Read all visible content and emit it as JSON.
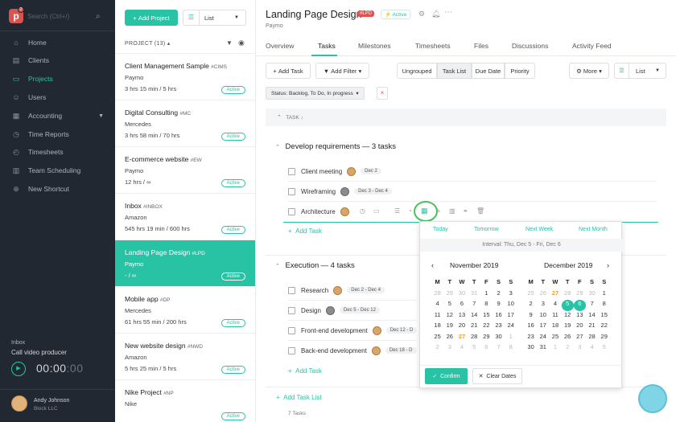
{
  "sidebar": {
    "logo_badge": "2",
    "search_placeholder": "Search (Ctrl+/)",
    "nav": [
      {
        "label": "Home",
        "icon": "home-icon"
      },
      {
        "label": "Clients",
        "icon": "clients-icon"
      },
      {
        "label": "Projects",
        "icon": "folder-icon"
      },
      {
        "label": "Users",
        "icon": "user-icon"
      },
      {
        "label": "Accounting",
        "icon": "accounting-icon"
      },
      {
        "label": "Time Reports",
        "icon": "clock-icon"
      },
      {
        "label": "Timesheets",
        "icon": "timesheet-icon"
      },
      {
        "label": "Team Scheduling",
        "icon": "calendar-icon"
      },
      {
        "label": "New Shortcut",
        "icon": "plus-circle-icon"
      }
    ],
    "inbox_label": "Inbox",
    "inbox_task": "Call video producer",
    "timer_main": "00:00",
    "timer_sec": ":00",
    "user_name": "Andy Johnson",
    "user_company": "Block LLC"
  },
  "project_list": {
    "add_button": "Add Project",
    "view": "List",
    "header": "PROJECT (13) ▴",
    "items": [
      {
        "name": "Client Management Sample",
        "code": "#CIMS",
        "client": "Paymo",
        "hours": "3 hrs 15 min / 5 hrs",
        "status": "Active"
      },
      {
        "name": "Digital Consulting",
        "code": "#MC",
        "client": "Mercedes",
        "hours": "3 hrs 58 min / 70 hrs",
        "status": "Active"
      },
      {
        "name": "E-commerce website",
        "code": "#EW",
        "client": "Paymo",
        "hours": "12 hrs / ∞",
        "status": "Active"
      },
      {
        "name": "Inbox",
        "code": "#INBOX",
        "client": "Amazon",
        "hours": "545 hrs 19 min / 600 hrs",
        "status": "Active"
      },
      {
        "name": "Landing Page Design",
        "code": "#LPD",
        "client": "Paymo",
        "hours": "- / ∞",
        "status": "Active"
      },
      {
        "name": "Mobile app",
        "code": "#DP",
        "client": "Mercedes",
        "hours": "61 hrs 55 min / 200 hrs",
        "status": "Active"
      },
      {
        "name": "New website design",
        "code": "#NWD",
        "client": "Amazon",
        "hours": "5 hrs 25 min / 5 hrs",
        "status": "Active"
      },
      {
        "name": "Nike Project",
        "code": "#NP",
        "client": "Nike",
        "hours": "",
        "status": "Active"
      }
    ]
  },
  "main": {
    "title": "Landing Page Design",
    "code_badge": "#LPD",
    "status": "Active",
    "client": "Paymo",
    "tabs": [
      "Overview",
      "Tasks",
      "Milestones",
      "Timesheets",
      "Files",
      "Discussions",
      "Activity Feed"
    ],
    "toolbar": {
      "add_task": "Add Task",
      "add_filter": "Add Filter",
      "segments": [
        "Ungrouped",
        "Task List",
        "Due Date",
        "Priority"
      ],
      "more": "More",
      "view": "List"
    },
    "status_filter": "Status: Backlog, To Do, In progress",
    "column_header": "TASK ↕",
    "groups": [
      {
        "title": "Develop requirements",
        "count": "— 3 tasks",
        "tasks": [
          {
            "name": "Client meeting",
            "date": "Dec 2"
          },
          {
            "name": "Wireframing",
            "date": "Dec 3 - Dec 4"
          },
          {
            "name": "Architecture",
            "date": ""
          }
        ]
      },
      {
        "title": "Execution",
        "count": "— 4 tasks",
        "tasks": [
          {
            "name": "Research",
            "date": "Dec 2 - Dec 4"
          },
          {
            "name": "Design",
            "date": "Dec 5 - Dec 12"
          },
          {
            "name": "Front-end development",
            "date": "Dec 12 - D"
          },
          {
            "name": "Back-end development",
            "date": "Dec 18 - D"
          }
        ]
      }
    ],
    "add_task_label": "Add Task",
    "add_task_list": "Add Task List",
    "footer_count": "7 Tasks"
  },
  "datepicker": {
    "quick": [
      "Today",
      "Tomorrow",
      "Next Week",
      "Next Month"
    ],
    "interval": "Interval: Thu, Dec 5 - Fri, Dec 6",
    "weekdays": [
      "M",
      "T",
      "W",
      "T",
      "F",
      "S",
      "S"
    ],
    "months": [
      {
        "title": "November 2019",
        "days": [
          [
            "28",
            "o"
          ],
          [
            "29",
            "o"
          ],
          [
            "30",
            "o"
          ],
          [
            "31",
            "o"
          ],
          [
            "1",
            "d"
          ],
          [
            "2",
            "d"
          ],
          [
            "3",
            "d"
          ],
          [
            "4",
            "d"
          ],
          [
            "5",
            "d"
          ],
          [
            "6",
            "d"
          ],
          [
            "7",
            "d"
          ],
          [
            "8",
            "d"
          ],
          [
            "9",
            "d"
          ],
          [
            "10",
            "d"
          ],
          [
            "11",
            "d"
          ],
          [
            "12",
            "d"
          ],
          [
            "13",
            "d"
          ],
          [
            "14",
            "d"
          ],
          [
            "15",
            "d"
          ],
          [
            "16",
            "d"
          ],
          [
            "17",
            "d"
          ],
          [
            "18",
            "d"
          ],
          [
            "19",
            "d"
          ],
          [
            "20",
            "d"
          ],
          [
            "21",
            "d"
          ],
          [
            "22",
            "d"
          ],
          [
            "23",
            "d"
          ],
          [
            "24",
            "d"
          ],
          [
            "25",
            "d"
          ],
          [
            "26",
            "d"
          ],
          [
            "27",
            "t"
          ],
          [
            "28",
            "d"
          ],
          [
            "29",
            "d"
          ],
          [
            "30",
            "d"
          ],
          [
            "1",
            "o"
          ],
          [
            "2",
            "o"
          ],
          [
            "3",
            "o"
          ],
          [
            "4",
            "o"
          ],
          [
            "5",
            "o"
          ],
          [
            "6",
            "o"
          ],
          [
            "7",
            "o"
          ],
          [
            "8",
            "o"
          ]
        ]
      },
      {
        "title": "December 2019",
        "days": [
          [
            "25",
            "o"
          ],
          [
            "26",
            "o"
          ],
          [
            "27",
            "t"
          ],
          [
            "28",
            "o"
          ],
          [
            "29",
            "o"
          ],
          [
            "30",
            "o"
          ],
          [
            "1",
            "d"
          ],
          [
            "2",
            "d"
          ],
          [
            "3",
            "d"
          ],
          [
            "4",
            "d"
          ],
          [
            "5",
            "s"
          ],
          [
            "6",
            "s"
          ],
          [
            "7",
            "d"
          ],
          [
            "8",
            "d"
          ],
          [
            "9",
            "d"
          ],
          [
            "10",
            "d"
          ],
          [
            "11",
            "d"
          ],
          [
            "12",
            "d"
          ],
          [
            "13",
            "d"
          ],
          [
            "14",
            "d"
          ],
          [
            "15",
            "d"
          ],
          [
            "16",
            "d"
          ],
          [
            "17",
            "d"
          ],
          [
            "18",
            "d"
          ],
          [
            "19",
            "d"
          ],
          [
            "20",
            "d"
          ],
          [
            "21",
            "d"
          ],
          [
            "22",
            "d"
          ],
          [
            "23",
            "d"
          ],
          [
            "24",
            "d"
          ],
          [
            "25",
            "d"
          ],
          [
            "26",
            "d"
          ],
          [
            "27",
            "d"
          ],
          [
            "28",
            "d"
          ],
          [
            "29",
            "d"
          ],
          [
            "30",
            "d"
          ],
          [
            "31",
            "d"
          ],
          [
            "1",
            "o"
          ],
          [
            "2",
            "o"
          ],
          [
            "3",
            "o"
          ],
          [
            "4",
            "o"
          ],
          [
            "5",
            "o"
          ]
        ]
      }
    ],
    "confirm": "Confirm",
    "clear": "Clear Dates"
  },
  "colors": {
    "accent": "#28c2a5",
    "sidebar_bg": "#222831",
    "badge_red": "#e05252"
  }
}
